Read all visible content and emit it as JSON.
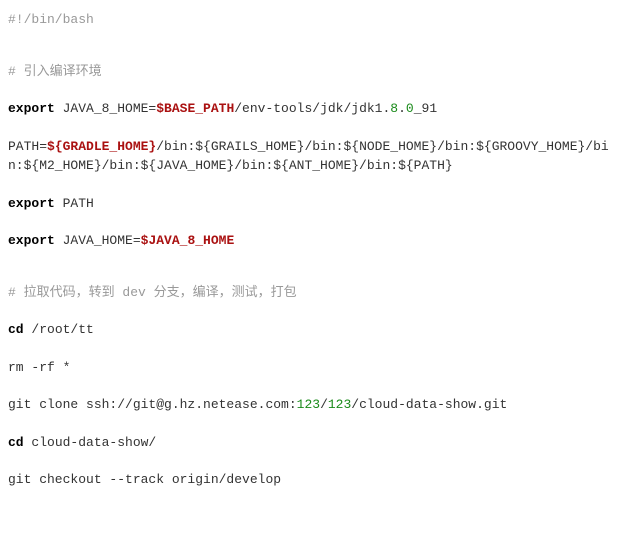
{
  "code": {
    "shebang": "#!/bin/bash",
    "comment1": "# 引入编译环境",
    "l1_kw": "export",
    "l1_a": " JAVA_8_HOME=",
    "l1_var": "$BASE_PATH",
    "l1_b": "/env-tools/jdk/jdk1.",
    "l1_num1": "8",
    "l1_c": ".",
    "l1_num2": "0",
    "l1_d": "_91",
    "l2_a": "PATH=",
    "l2_var": "${GRADLE_HOME}",
    "l2_b": "/bin:${GRAILS_HOME}/bin:${NODE_HOME}/bin:${GROOVY_HOME}/bin:${M2_HOME}/bin:${JAVA_HOME}/bin:${ANT_HOME}/bin:${PATH}",
    "l3_kw": "export",
    "l3_a": " PATH",
    "l4_kw": "export",
    "l4_a": " JAVA_HOME=",
    "l4_var": "$JAVA_8_HOME",
    "comment2": "# 拉取代码，转到 dev 分支，编译，测试，打包",
    "l5_cmd": "cd",
    "l5_a": " /root/tt",
    "l6": "rm -rf *",
    "l7_a": "git clone ssh://git@g.hz.netease.com:",
    "l7_num1": "123",
    "l7_b": "/",
    "l7_num2": "123",
    "l7_c": "/cloud-data-show.git",
    "l8_cmd": "cd",
    "l8_a": " cloud-data-show/",
    "l9": "git checkout --track origin/develop"
  }
}
